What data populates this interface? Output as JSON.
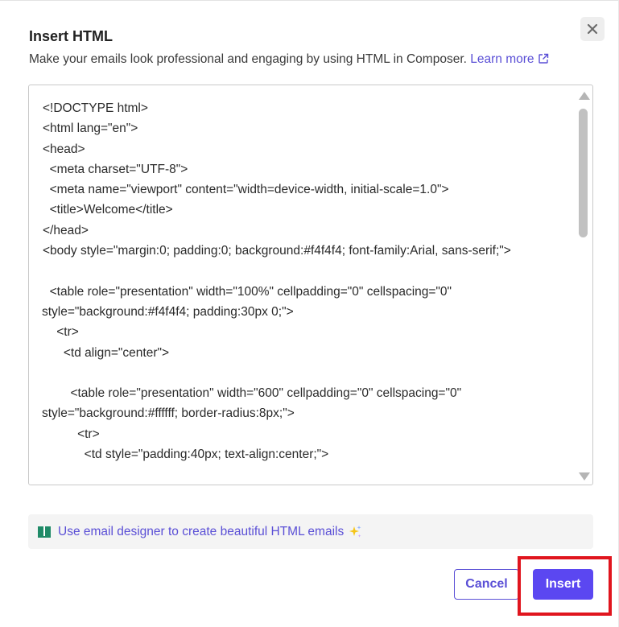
{
  "dialog": {
    "title": "Insert HTML",
    "subtitle": "Make your emails look professional and engaging by using HTML in Composer.",
    "learn_more": "Learn more",
    "close_icon": "close-icon",
    "external_icon": "external-link-icon"
  },
  "editor": {
    "lines": [
      "<!DOCTYPE html>",
      "<html lang=\"en\">",
      "<head>",
      "  <meta charset=\"UTF-8\">",
      "  <meta name=\"viewport\" content=\"width=device-width, initial-scale=1.0\">",
      "  <title>Welcome</title>",
      "</head>",
      "<body style=\"margin:0; padding:0; background:#f4f4f4; font-family:Arial, sans-serif;\">",
      "",
      "  <table role=\"presentation\" width=\"100%\" cellpadding=\"0\" cellspacing=\"0\"",
      "style=\"background:#f4f4f4; padding:30px 0;\">",
      "    <tr>",
      "      <td align=\"center\">",
      "",
      "        <table role=\"presentation\" width=\"600\" cellpadding=\"0\" cellspacing=\"0\"",
      "style=\"background:#ffffff; border-radius:8px;\">",
      "          <tr>",
      "            <td style=\"padding:40px; text-align:center;\">"
    ],
    "wrapped_lines": [
      10,
      15
    ]
  },
  "banner": {
    "text": "Use email designer to create beautiful HTML emails",
    "book_icon": "book-icon",
    "sparkle_icon": "sparkle-icon"
  },
  "footer": {
    "cancel_label": "Cancel",
    "insert_label": "Insert"
  },
  "colors": {
    "accent": "#5b47f1",
    "link": "#5a4fd6",
    "highlight": "#e0151e",
    "banner_bg": "#f4f4f4"
  }
}
